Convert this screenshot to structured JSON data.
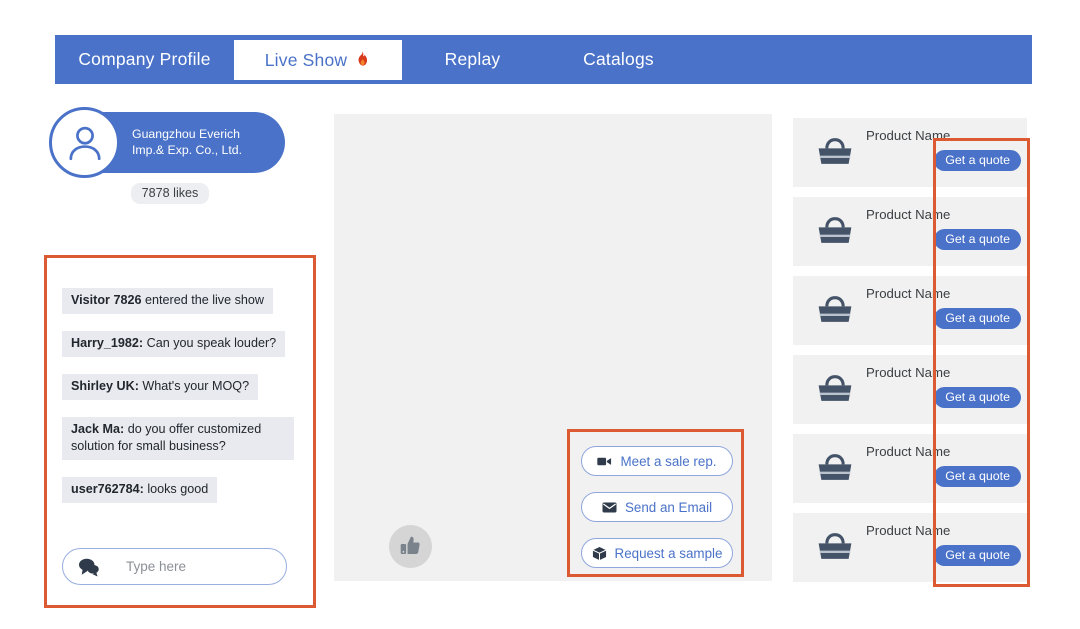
{
  "nav": {
    "items": [
      {
        "label": "Company Profile",
        "active": false,
        "icon": null
      },
      {
        "label": "Live Show",
        "active": true,
        "icon": "flame-icon",
        "icon_glyph": "🔥"
      },
      {
        "label": "Replay",
        "active": false,
        "icon": null
      },
      {
        "label": "Catalogs",
        "active": false,
        "icon": null
      }
    ],
    "bar_color": "#4a72c8",
    "active_tab_bg": "#ffffff",
    "active_tab_text": "#4a72c8"
  },
  "profile": {
    "company_line1": "Guangzhou Everich",
    "company_line2": "Imp.& Exp. Co., Ltd.",
    "avatar_icon": "user-avatar-icon",
    "likes": "7878 likes",
    "pill_color": "#4a72c8"
  },
  "chat": {
    "highlight_color": "#dc5a32",
    "messages": [
      {
        "author": "Visitor 7826",
        "text": " entered the live show",
        "author_only": true
      },
      {
        "author": "Harry_1982:",
        "text": " Can you speak louder?"
      },
      {
        "author": "Shirley UK:",
        "text": " What's your MOQ?"
      },
      {
        "author": " Jack Ma:",
        "text": " do you offer customized solution for small business?"
      },
      {
        "author": "user762784:",
        "text": " looks good"
      }
    ],
    "input": {
      "placeholder": "Type here",
      "value": "",
      "icon": "chat-bubble-icon"
    }
  },
  "video": {
    "background": "#f1f1f1",
    "like_icon": "thumbs-up-icon"
  },
  "cta": {
    "highlight_color": "#dc5a32",
    "buttons": [
      {
        "label": "Meet a sale rep.",
        "icon": "video-camera-icon"
      },
      {
        "label": "Send an Email",
        "icon": "envelope-icon"
      },
      {
        "label": "Request a sample",
        "icon": "box-package-icon"
      }
    ]
  },
  "products": {
    "highlight_color": "#dc5a32",
    "quote_label": "Get a quote",
    "items": [
      {
        "name": "Product Name",
        "icon": "handbag-icon",
        "quote_label": "Get a quote"
      },
      {
        "name": "Product Name",
        "icon": "handbag-icon",
        "quote_label": "Get a quote"
      },
      {
        "name": "Product Name",
        "icon": "handbag-icon",
        "quote_label": "Get a quote"
      },
      {
        "name": "Product Name",
        "icon": "handbag-icon",
        "quote_label": "Get a quote"
      },
      {
        "name": "Product Name",
        "icon": "handbag-icon",
        "quote_label": "Get a quote"
      },
      {
        "name": "Product Name",
        "icon": "handbag-icon",
        "quote_label": "Get a quote"
      }
    ]
  }
}
